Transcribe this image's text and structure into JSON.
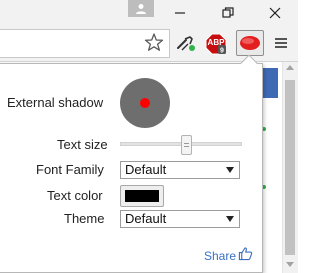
{
  "browser": {
    "icons": {
      "profile": "person-icon",
      "minimize": "minimize-icon",
      "maximize": "restore-icon",
      "close": "close-icon",
      "bookmark": "star-icon",
      "ext_tool": "rocket-extension-icon",
      "ext_adblock": "adblock-plus-icon",
      "ext_active": "text-shadow-extension-icon",
      "menu": "hamburger-menu-icon"
    },
    "adblock_label": "ABP",
    "colors": {
      "titlebar": "#f2f2f2",
      "adblock": "#c70d0d",
      "extension_active": "#e31e1e"
    }
  },
  "popup": {
    "external_shadow_label": "External shadow",
    "shadow_color": "#6e6e6e",
    "shadow_dot_color": "#ff0000",
    "text_size_label": "Text size",
    "text_size_value": 0.55,
    "font_family_label": "Font Family",
    "font_family_value": "Default",
    "text_color_label": "Text color",
    "text_color_value": "#000000",
    "theme_label": "Theme",
    "theme_value": "Default",
    "share_label": "Share",
    "share_icon": "thumbs-up-icon",
    "link_color": "#3b6fc4"
  }
}
